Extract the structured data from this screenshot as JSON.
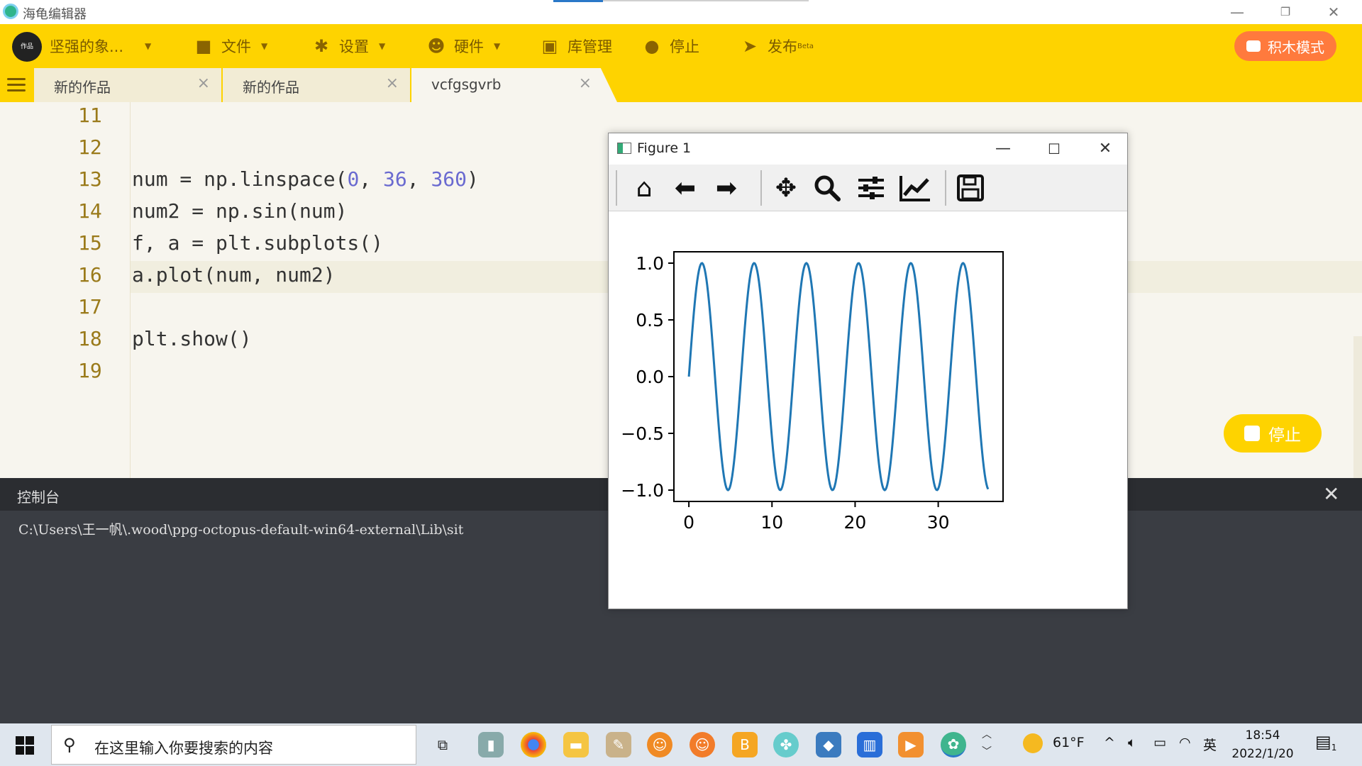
{
  "app": {
    "title": "海龟编辑器"
  },
  "toolbar": {
    "user_name": "坚强的象...",
    "avatar_text": "作品",
    "file": "文件",
    "settings": "设置",
    "hardware": "硬件",
    "library": "库管理",
    "stop": "停止",
    "publish": "发布",
    "beta": "Beta",
    "blocks_mode": "积木模式"
  },
  "tabs": [
    {
      "label": "新的作品"
    },
    {
      "label": "新的作品"
    },
    {
      "label": "vcfgsgvrb"
    }
  ],
  "editor": {
    "lines": [
      {
        "n": "11",
        "code": ""
      },
      {
        "n": "12",
        "code": ""
      },
      {
        "n": "13",
        "code": "num = np.linspace(0, 36, 360)"
      },
      {
        "n": "14",
        "code": "num2 = np.sin(num)"
      },
      {
        "n": "15",
        "code": "f, a = plt.subplots()"
      },
      {
        "n": "16",
        "code": "a.plot(num, num2)"
      },
      {
        "n": "17",
        "code": ""
      },
      {
        "n": "18",
        "code": "plt.show()"
      },
      {
        "n": "19",
        "code": ""
      }
    ],
    "stop_button": "停止"
  },
  "console": {
    "title": "控制台",
    "output": "C:\\Users\\王一帆\\.wood\\ppg-octopus-default-win64-external\\Lib\\sit"
  },
  "figure": {
    "title": "Figure 1",
    "toolbar_icons": [
      "home-icon",
      "back-icon",
      "forward-icon",
      "pan-icon",
      "zoom-icon",
      "subplots-icon",
      "edit-curve-icon",
      "save-icon"
    ],
    "line_color": "#1f77b4"
  },
  "chart_data": {
    "type": "line",
    "title": "",
    "xlabel": "",
    "ylabel": "",
    "function": "sin(x)",
    "x_start": 0,
    "x_end": 36,
    "num_points": 360,
    "xlim": [
      -1.8,
      37.8
    ],
    "ylim": [
      -1.1,
      1.1
    ],
    "xticks": [
      "0",
      "10",
      "20",
      "30"
    ],
    "xtick_values": [
      0,
      10,
      20,
      30
    ],
    "yticks": [
      "1.0",
      "0.5",
      "0.0",
      "−0.5",
      "−1.0"
    ],
    "ytick_values": [
      1.0,
      0.5,
      0.0,
      -0.5,
      -1.0
    ],
    "grid": false,
    "legend": "none"
  },
  "taskbar": {
    "search_placeholder": "在这里输入你要搜索的内容",
    "weather": "61°F",
    "ime": "英",
    "time": "18:54",
    "date": "2022/1/20",
    "notification_count": "1"
  }
}
